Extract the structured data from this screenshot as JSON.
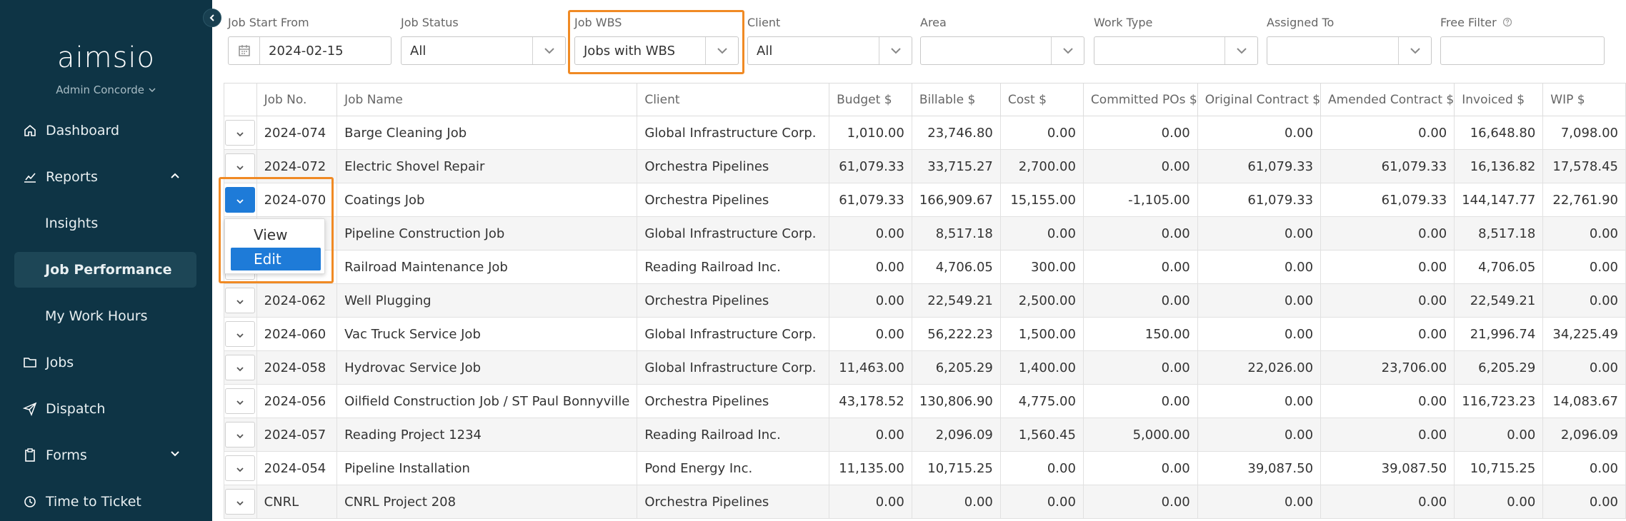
{
  "sidebar": {
    "brand": "aimsio",
    "user": "Admin Concorde",
    "nav": [
      {
        "label": "Dashboard",
        "icon": "home-icon"
      },
      {
        "label": "Reports",
        "icon": "chart-icon"
      },
      {
        "label": "Insights"
      },
      {
        "label": "Job Performance"
      },
      {
        "label": "My Work Hours"
      },
      {
        "label": "Jobs",
        "icon": "folder-icon"
      },
      {
        "label": "Dispatch",
        "icon": "send-icon"
      },
      {
        "label": "Forms",
        "icon": "clipboard-icon"
      },
      {
        "label": "Time to Ticket",
        "icon": "clock-icon"
      }
    ]
  },
  "filters": {
    "job_start_from": {
      "label": "Job Start From",
      "value": "2024-02-15"
    },
    "job_status": {
      "label": "Job Status",
      "value": "All"
    },
    "job_wbs": {
      "label": "Job WBS",
      "value": "Jobs with WBS"
    },
    "client": {
      "label": "Client",
      "value": "All"
    },
    "area": {
      "label": "Area",
      "value": ""
    },
    "work_type": {
      "label": "Work Type",
      "value": ""
    },
    "assigned_to": {
      "label": "Assigned To",
      "value": ""
    },
    "free_filter": {
      "label": "Free Filter",
      "value": ""
    }
  },
  "table": {
    "columns": [
      "",
      "Job No.",
      "Job Name",
      "Client",
      "Budget $",
      "Billable $",
      "Cost $",
      "Committed POs $",
      "Original Contract $",
      "Amended Contract $",
      "Invoiced $",
      "WIP $"
    ],
    "rows": [
      [
        "2024-074",
        "Barge Cleaning Job",
        "Global Infrastructure Corp.",
        "1,010.00",
        "23,746.80",
        "0.00",
        "0.00",
        "0.00",
        "0.00",
        "16,648.80",
        "7,098.00"
      ],
      [
        "2024-072",
        "Electric Shovel Repair",
        "Orchestra Pipelines",
        "61,079.33",
        "33,715.27",
        "2,700.00",
        "0.00",
        "61,079.33",
        "61,079.33",
        "16,136.82",
        "17,578.45"
      ],
      [
        "2024-070",
        "Coatings Job",
        "Orchestra Pipelines",
        "61,079.33",
        "166,909.67",
        "15,155.00",
        "-1,105.00",
        "61,079.33",
        "61,079.33",
        "144,147.77",
        "22,761.90"
      ],
      [
        "",
        "Pipeline Construction Job",
        "Global Infrastructure Corp.",
        "0.00",
        "8,517.18",
        "0.00",
        "0.00",
        "0.00",
        "0.00",
        "8,517.18",
        "0.00"
      ],
      [
        "",
        "Railroad Maintenance Job",
        "Reading Railroad Inc.",
        "0.00",
        "4,706.05",
        "300.00",
        "0.00",
        "0.00",
        "0.00",
        "4,706.05",
        "0.00"
      ],
      [
        "2024-062",
        "Well Plugging",
        "Orchestra Pipelines",
        "0.00",
        "22,549.21",
        "2,500.00",
        "0.00",
        "0.00",
        "0.00",
        "22,549.21",
        "0.00"
      ],
      [
        "2024-060",
        "Vac Truck Service Job",
        "Global Infrastructure Corp.",
        "0.00",
        "56,222.23",
        "1,500.00",
        "150.00",
        "0.00",
        "0.00",
        "21,996.74",
        "34,225.49"
      ],
      [
        "2024-058",
        "Hydrovac Service Job",
        "Global Infrastructure Corp.",
        "11,463.00",
        "6,205.29",
        "1,400.00",
        "0.00",
        "22,026.00",
        "23,706.00",
        "6,205.29",
        "0.00"
      ],
      [
        "2024-056",
        "Oilfield Construction Job / ST Paul Bonnyville",
        "Orchestra Pipelines",
        "43,178.52",
        "130,806.90",
        "4,775.00",
        "0.00",
        "0.00",
        "0.00",
        "116,723.23",
        "14,083.67"
      ],
      [
        "2024-057",
        "Reading Project 1234",
        "Reading Railroad Inc.",
        "0.00",
        "2,096.09",
        "1,560.45",
        "5,000.00",
        "0.00",
        "0.00",
        "0.00",
        "2,096.09"
      ],
      [
        "2024-054",
        "Pipeline Installation",
        "Pond Energy Inc.",
        "11,135.00",
        "10,715.25",
        "0.00",
        "0.00",
        "39,087.50",
        "39,087.50",
        "10,715.25",
        "0.00"
      ],
      [
        "CNRL",
        "CNRL Project 208",
        "Orchestra Pipelines",
        "0.00",
        "0.00",
        "0.00",
        "0.00",
        "0.00",
        "0.00",
        "0.00",
        "0.00"
      ]
    ]
  },
  "row_menu": {
    "items": [
      "View",
      "Edit"
    ],
    "selected": "Edit"
  },
  "colors": {
    "sidebar": "#0e3445",
    "accent": "#1e7bd8",
    "highlight": "#f08a24"
  }
}
